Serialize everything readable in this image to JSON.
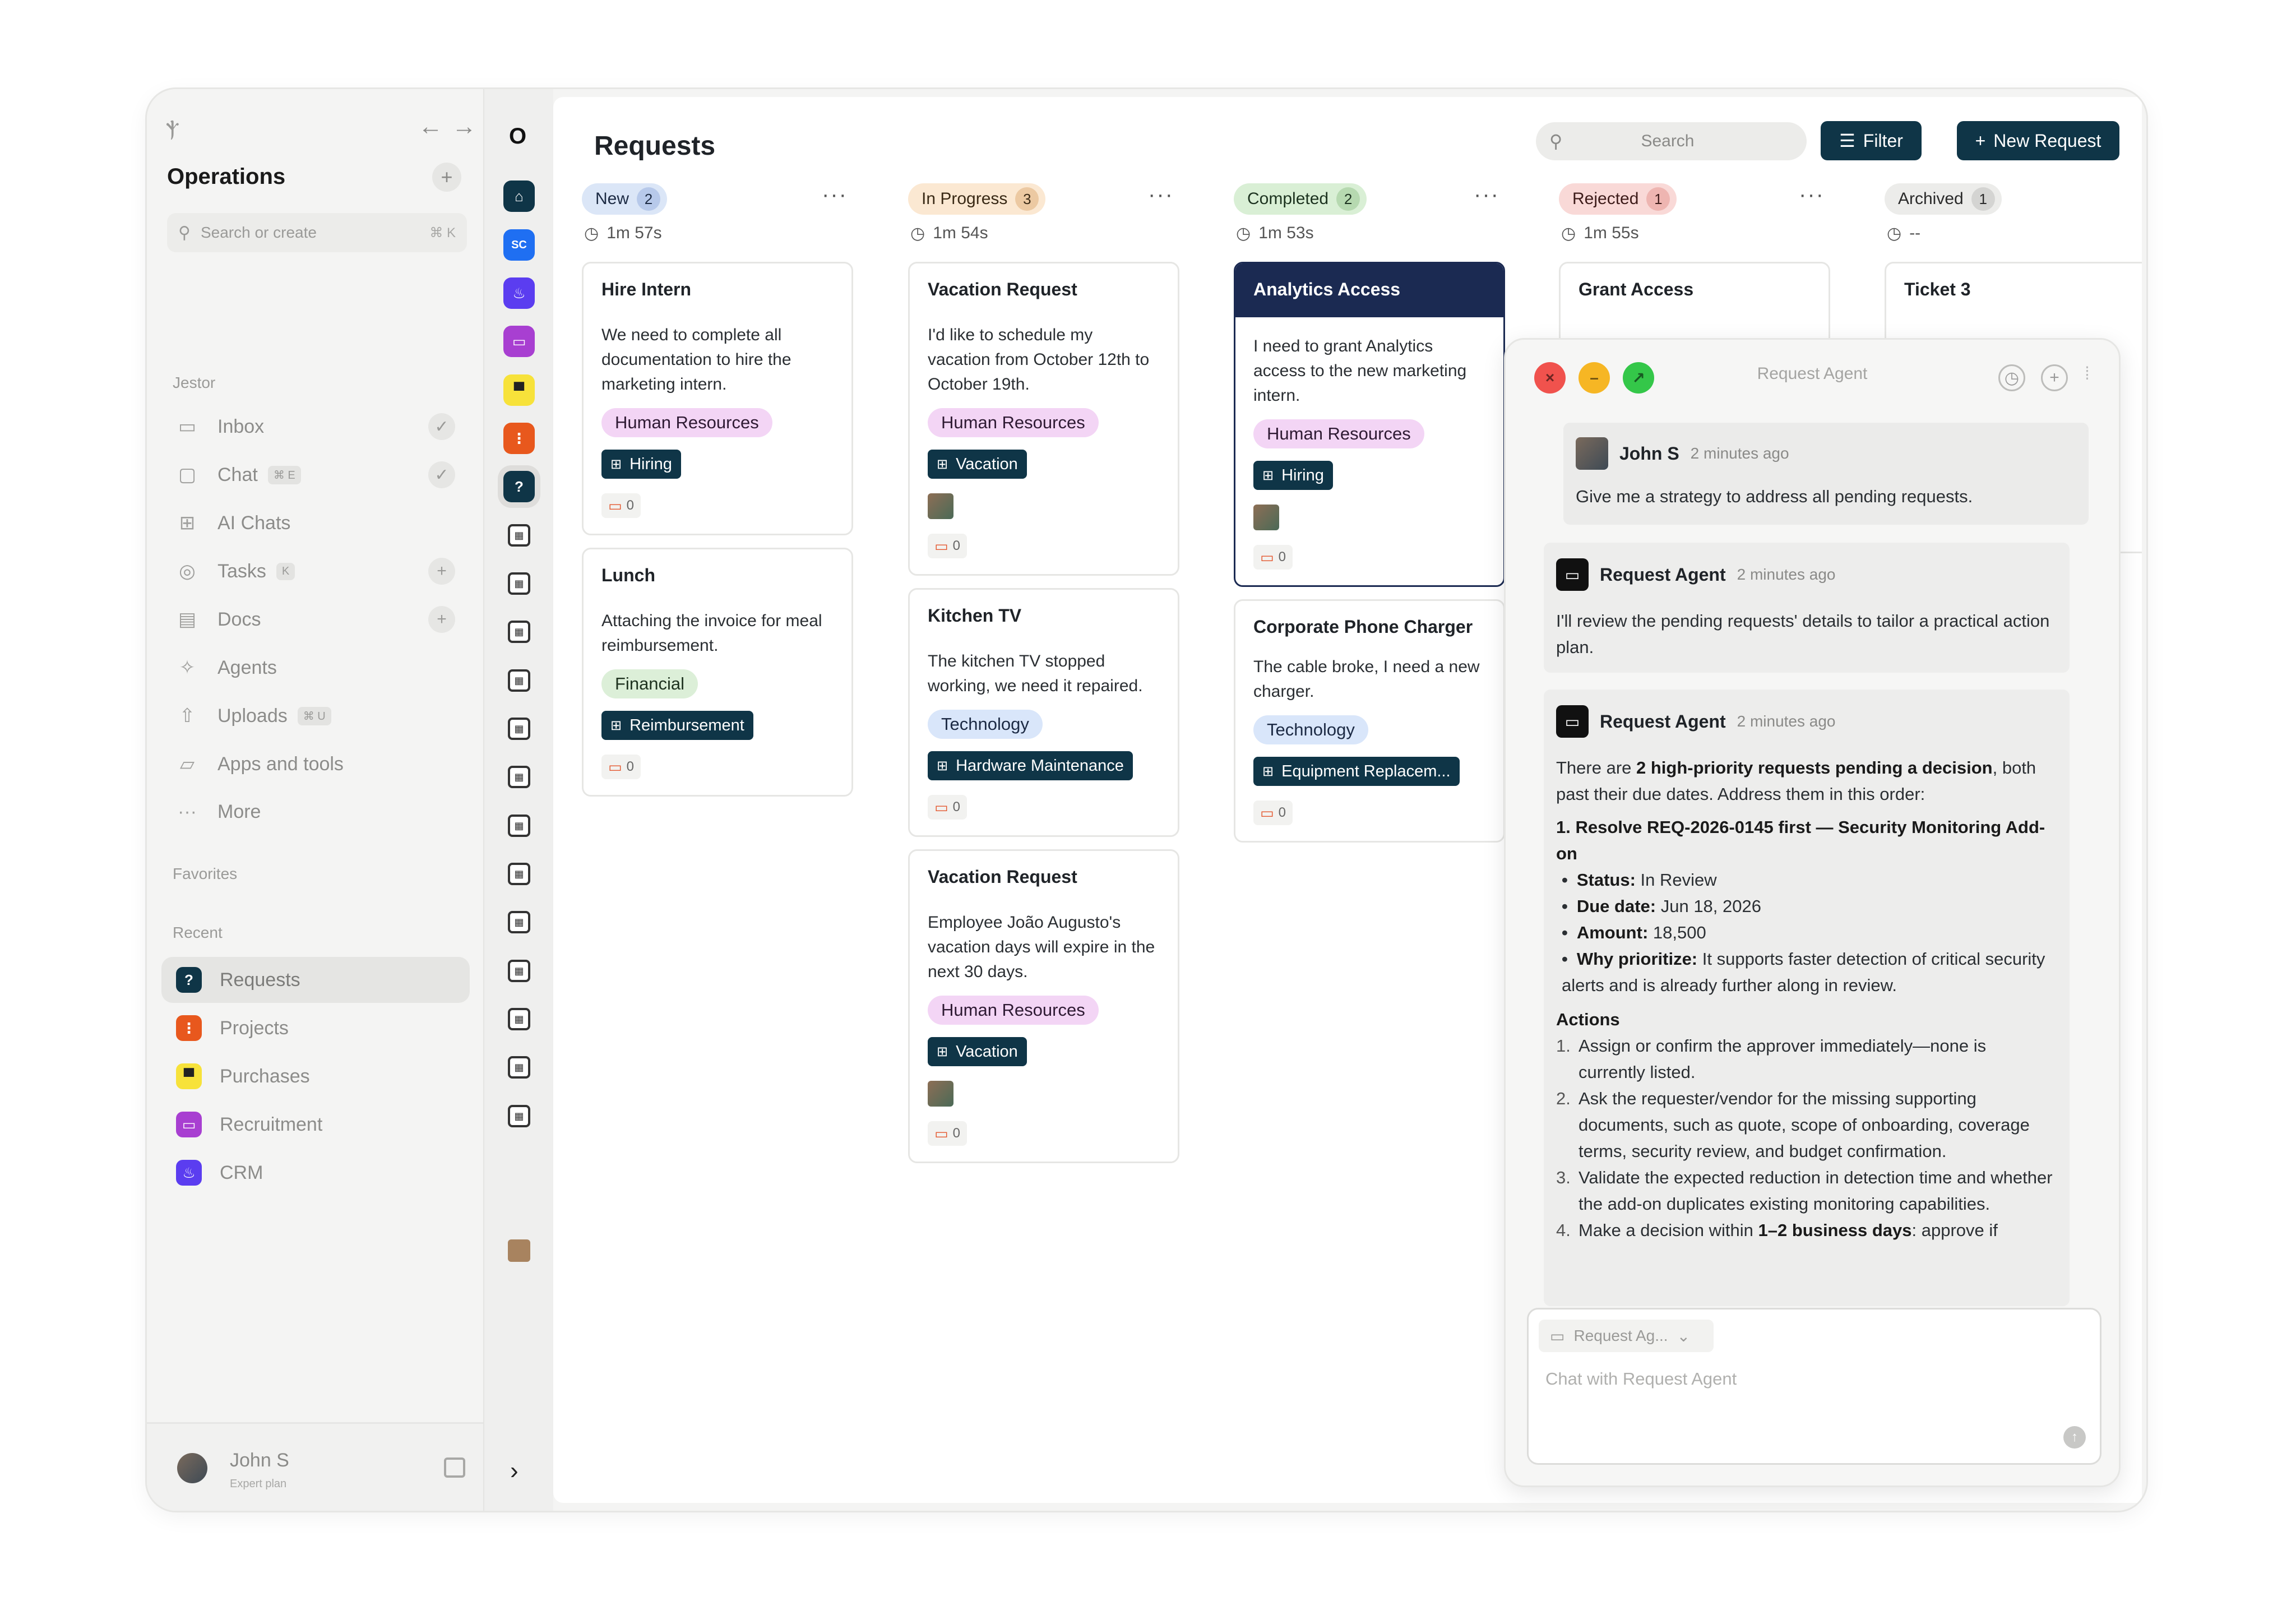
{
  "colors": {
    "accent": "#0f3547",
    "analytics_card": "#1b2a52",
    "human_resources_tag": "#f3d5f5",
    "financial_tag": "#dcefd8",
    "technology_tag": "#d9e6fa",
    "new_pill": "#dbe6f7",
    "in_progress_pill": "#fbe8d2",
    "completed_pill": "#d9efd5",
    "rejected_pill": "#f9d9d7",
    "archived_pill": "#ececea"
  },
  "sidebar": {
    "workspace": "Operations",
    "search_placeholder": "Search or create",
    "search_shortcut": "⌘ K",
    "section_jestor": "Jestor",
    "items": [
      {
        "label": "Inbox",
        "icon": "inbox-icon"
      },
      {
        "label": "Chat",
        "icon": "chat-icon",
        "kbd": "⌘ E"
      },
      {
        "label": "AI Chats",
        "icon": "ai-chat-icon"
      },
      {
        "label": "Tasks",
        "icon": "check-circle-icon",
        "kbd": "K"
      },
      {
        "label": "Docs",
        "icon": "doc-icon"
      },
      {
        "label": "Agents",
        "icon": "sparkle-icon"
      },
      {
        "label": "Uploads",
        "icon": "upload-icon",
        "kbd": "⌘ U"
      },
      {
        "label": "Apps and tools",
        "icon": "folder-icon"
      },
      {
        "label": "More",
        "icon": "dots-icon"
      }
    ],
    "section_favorites": "Favorites",
    "section_recent": "Recent",
    "recent": [
      {
        "label": "Requests",
        "color": "#0f3547"
      },
      {
        "label": "Projects",
        "color": "#e8581d"
      },
      {
        "label": "Purchases",
        "color": "#f7e23a"
      },
      {
        "label": "Recruitment",
        "color": "#a83fd1"
      },
      {
        "label": "CRM",
        "color": "#5b3df0"
      }
    ],
    "user": {
      "name": "John S",
      "plan": "Expert plan"
    }
  },
  "rail": {
    "brand": "O",
    "sc_label": "SC"
  },
  "header": {
    "title": "Requests",
    "search_placeholder": "Search",
    "filter_label": "Filter",
    "new_label": "New Request"
  },
  "columns": [
    {
      "status": "New",
      "count": "2",
      "time": "1m 57s"
    },
    {
      "status": "In Progress",
      "count": "3",
      "time": "1m 54s"
    },
    {
      "status": "Completed",
      "count": "2",
      "time": "1m 53s"
    },
    {
      "status": "Rejected",
      "count": "1",
      "time": "1m 55s"
    },
    {
      "status": "Archived",
      "count": "1",
      "time": "--"
    }
  ],
  "cards": {
    "hire_intern": {
      "title": "Hire Intern",
      "desc": "We need to complete all documentation to hire the marketing intern.",
      "tag": "Human Resources",
      "chip": "Hiring",
      "comments": "0"
    },
    "lunch": {
      "title": "Lunch",
      "desc": "Attaching the invoice for meal reimbursement.",
      "tag": "Financial",
      "chip": "Reimbursement",
      "comments": "0"
    },
    "vacation_1": {
      "title": "Vacation Request",
      "desc": "I'd like to schedule my vacation from October 12th to October 19th.",
      "tag": "Human Resources",
      "chip": "Vacation",
      "comments": "0"
    },
    "kitchen_tv": {
      "title": "Kitchen TV",
      "desc": "The kitchen TV stopped working, we need it repaired.",
      "tag": "Technology",
      "chip": "Hardware Maintenance",
      "comments": "0"
    },
    "vacation_2": {
      "title": "Vacation Request",
      "desc": "Employee João Augusto's vacation days will expire in the next 30 days.",
      "tag": "Human Resources",
      "chip": "Vacation",
      "comments": "0"
    },
    "analytics": {
      "title": "Analytics Access",
      "desc": "I need to grant Analytics access to the new marketing intern.",
      "tag": "Human Resources",
      "chip": "Hiring",
      "comments": "0"
    },
    "phone_charger": {
      "title": "Corporate Phone Charger",
      "desc": "The cable broke, I need a new charger.",
      "tag": "Technology",
      "chip": "Equipment Replacem...",
      "comments": "0"
    },
    "grant_access": {
      "title": "Grant Access"
    },
    "ticket_3": {
      "title": "Ticket 3"
    }
  },
  "agent": {
    "title": "Request Agent",
    "user_msg": {
      "name": "John S",
      "time": "2 minutes ago",
      "text": "Give me a strategy to address all pending requests."
    },
    "reply1": {
      "name": "Request Agent",
      "time": "2 minutes ago",
      "text": "I'll review the pending requests' details to tailor a practical action plan."
    },
    "reply2": {
      "name": "Request Agent",
      "time": "2 minutes ago",
      "intro_a": "There are ",
      "intro_bold": "2 high-priority requests pending a decision",
      "intro_b": ", both past their due dates. Address them in this order:",
      "item_heading": "1. Resolve REQ-2026-0145 first — Security Monitoring Add-on",
      "status_label": "Status:",
      "status_value": " In Review",
      "due_label": "Due date:",
      "due_value": " Jun 18, 2026",
      "amount_label": "Amount:",
      "amount_value": " 18,500",
      "why_label": "Why prioritize:",
      "why_value": " It supports faster detection of critical security alerts and is already further along in review.",
      "actions_heading": "Actions",
      "actions": [
        "Assign or confirm the approver immediately—none is currently listed.",
        "Ask the requester/vendor for the missing supporting documents, such as quote, scope of onboarding, coverage terms, security review, and budget confirmation.",
        "Validate the expected reduction in detection time and whether the add-on duplicates existing monitoring capabilities."
      ],
      "action4_a": "Make a decision within ",
      "action4_bold": "1–2 business days",
      "action4_b": ": approve if"
    },
    "composer_agent": "Request Ag...",
    "composer_placeholder": "Chat with Request Agent"
  }
}
